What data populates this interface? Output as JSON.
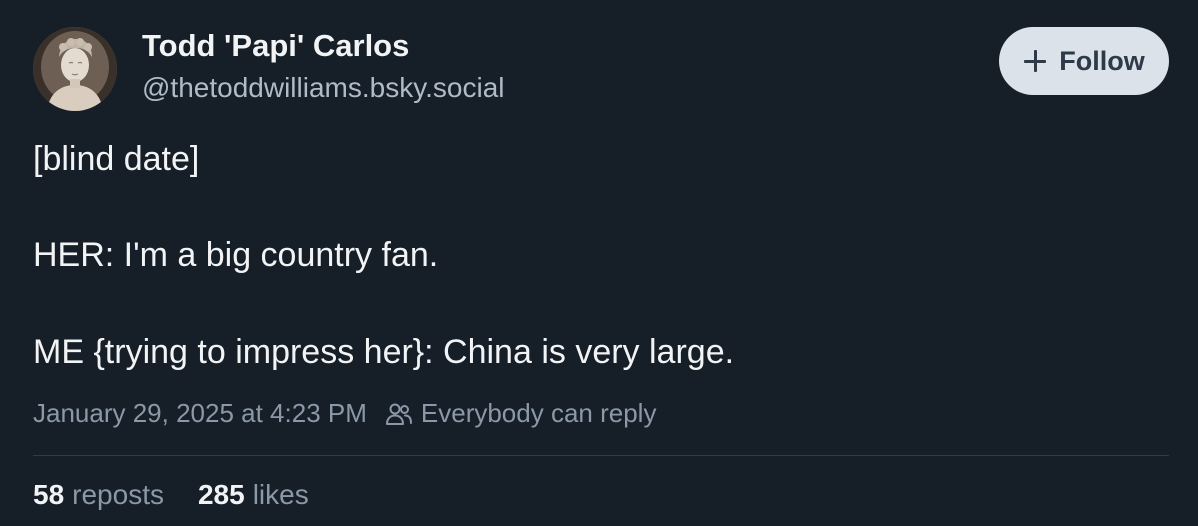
{
  "author": {
    "display_name": "Todd 'Papi' Carlos",
    "handle": "@thetoddwilliams.bsky.social",
    "avatar_icon": "marble-bust-avatar"
  },
  "follow_button": {
    "icon": "plus-icon",
    "label": "Follow"
  },
  "post": {
    "lines": [
      "[blind date]",
      "HER: I'm a big country fan.",
      "ME {trying to impress her}: China is very large."
    ],
    "timestamp": "January 29, 2025 at 4:23 PM",
    "reply_setting_icon": "people-icon",
    "reply_setting": "Everybody can reply"
  },
  "stats": {
    "reposts_count": "58",
    "reposts_label": "reposts",
    "likes_count": "285",
    "likes_label": "likes"
  },
  "colors": {
    "background": "#161e27",
    "primary_text": "#f1f3f5",
    "secondary_text": "#8a98a8",
    "follow_button_bg": "#dce2ea"
  }
}
